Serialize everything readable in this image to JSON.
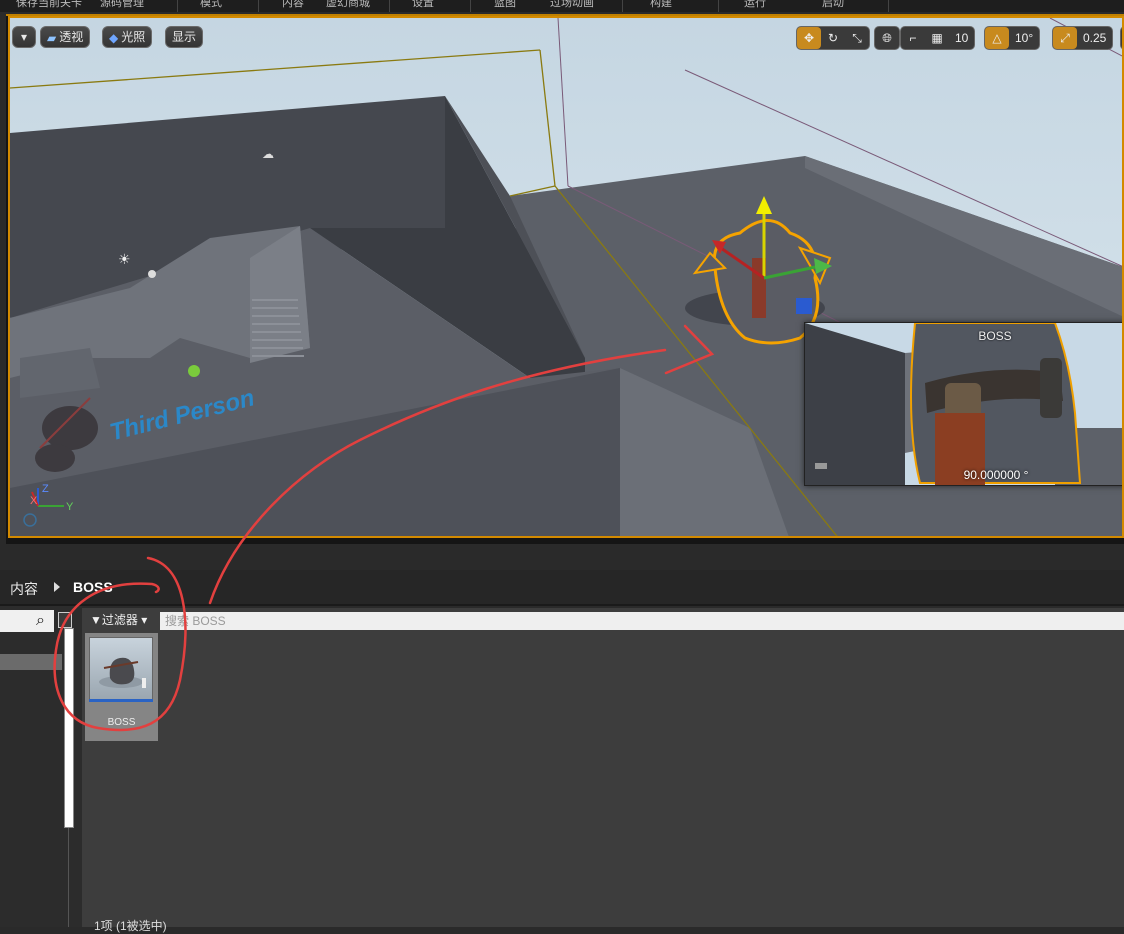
{
  "menu": {
    "items": [
      "保存当前关卡",
      "源码管理",
      "模式",
      "内容",
      "虚幻商城",
      "设置",
      "蓝图",
      "过场动画",
      "构建",
      "运行",
      "启动"
    ]
  },
  "viewport": {
    "dropdown_label": "",
    "perspective_label": "透视",
    "lighting_label": "光照",
    "show_label": "显示",
    "grid_snap_value": "10",
    "rotation_snap_value": "10°",
    "scale_snap_value": "0.25",
    "floor_text": "Third Person",
    "axis_labels": {
      "z": "Z",
      "x": "X",
      "y": "Y"
    },
    "colors": {
      "selection": "#d38a00",
      "accent": "#c88a1e"
    }
  },
  "preview": {
    "title": "BOSS",
    "angle": "90.000000 °"
  },
  "content_browser": {
    "breadcrumb_root": "内容",
    "breadcrumb_folder": "BOSS",
    "filter_label": "过滤器",
    "search_placeholder": "搜索 BOSS",
    "asset_name": "BOSS",
    "status": "1项 (1被选中)"
  },
  "icons": [
    "search-icon",
    "view-options-icon",
    "filter-icon",
    "translate-icon",
    "rotate-icon",
    "scale-icon",
    "world-icon",
    "surface-snap-icon",
    "grid-icon",
    "angle-icon",
    "scale-snap-icon",
    "camera-speed-icon"
  ]
}
